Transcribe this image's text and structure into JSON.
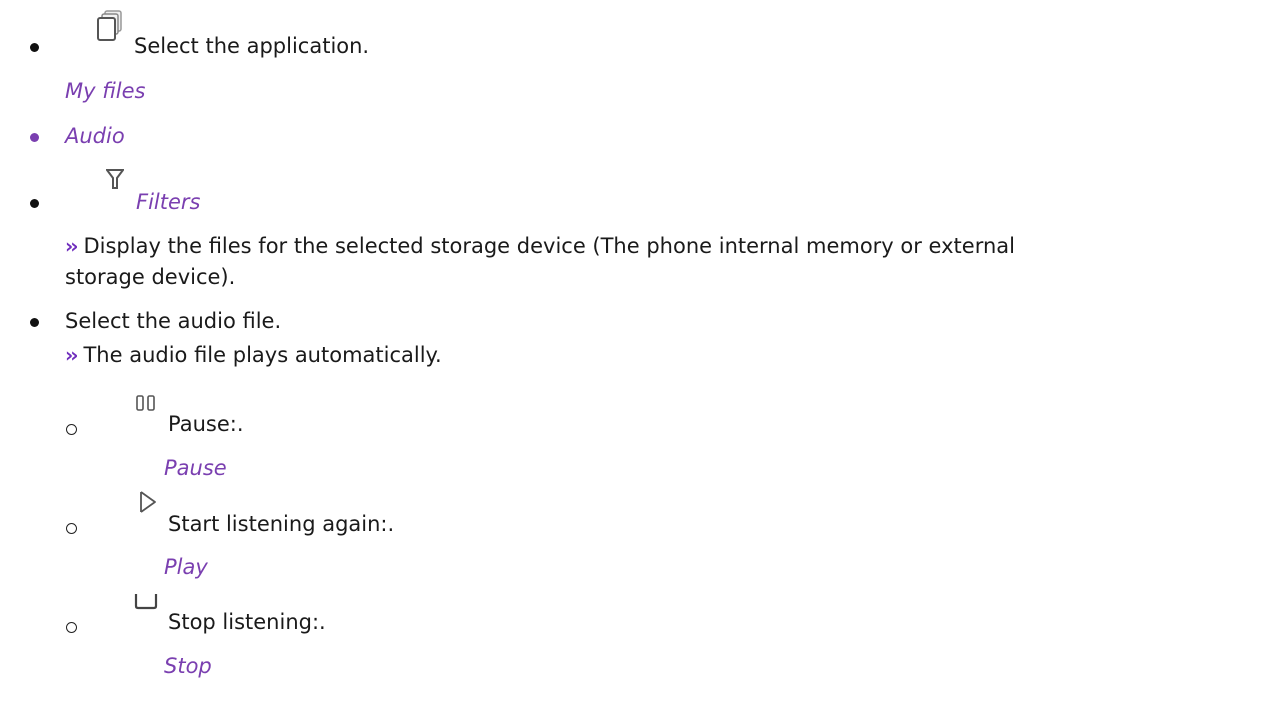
{
  "steps": {
    "step1": {
      "text": "Select the application.",
      "sub": "My files",
      "icon": "my-files-icon"
    },
    "step2": {
      "text": "Audio"
    },
    "step3": {
      "text": "Filters",
      "icon": "filter-icon",
      "result_line1": "Display the files for the selected storage device (The phone internal memory or external",
      "result_line2": "storage device)."
    },
    "step4": {
      "text": "Select the audio file.",
      "result": "The audio file plays automatically."
    }
  },
  "controls": {
    "pause": {
      "text": "Pause:.",
      "sub": "Pause",
      "icon": "pause-icon"
    },
    "play": {
      "text": "Start listening again:.",
      "sub": "Play",
      "icon": "play-icon"
    },
    "stop": {
      "text": "Stop listening:.",
      "sub": "Stop",
      "icon": "stop-icon"
    }
  },
  "result_marker": "››",
  "colors": {
    "accent": "#7a3fb0",
    "arrow": "#6f2dbd",
    "text": "#1a1a1a"
  }
}
